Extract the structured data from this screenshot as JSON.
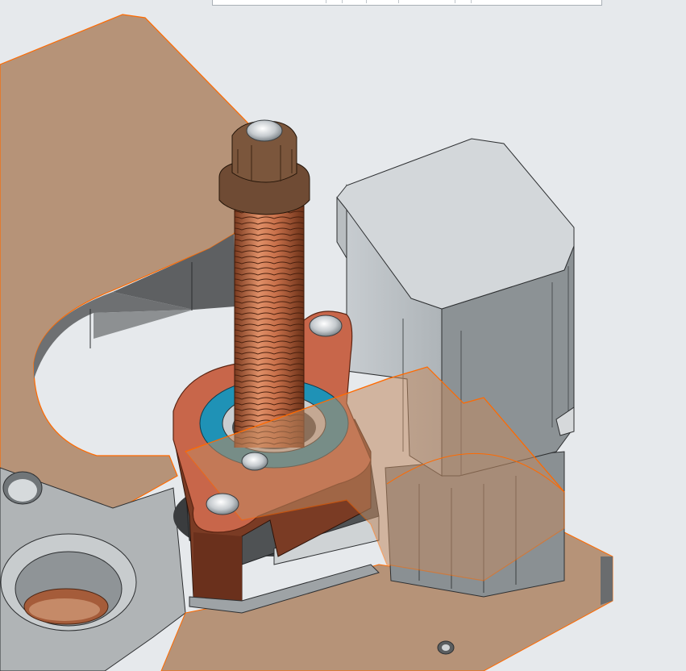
{
  "app": {
    "view": "3d-cad-viewport",
    "icons": [
      "toolbar-strip",
      "orientation-none"
    ]
  },
  "model": {
    "parts": [
      "base-plate",
      "transparent-cover-plate",
      "lead-screw",
      "flange-nut",
      "bearing-ring",
      "stepper-motor",
      "pulley",
      "bolt-head",
      "bottom-plate"
    ]
  },
  "colors": {
    "background": "#e6e9ec",
    "plate_copper": "#b69378",
    "selection_outline": "#ff6a00",
    "screw_copper": "#c8704a",
    "flange_orange": "#c8664a",
    "bearing_blue": "#1f92b6",
    "motor_light": "#c9cdd0",
    "motor_dark": "#7d8386",
    "plate_grey": "#aeb2b4"
  }
}
